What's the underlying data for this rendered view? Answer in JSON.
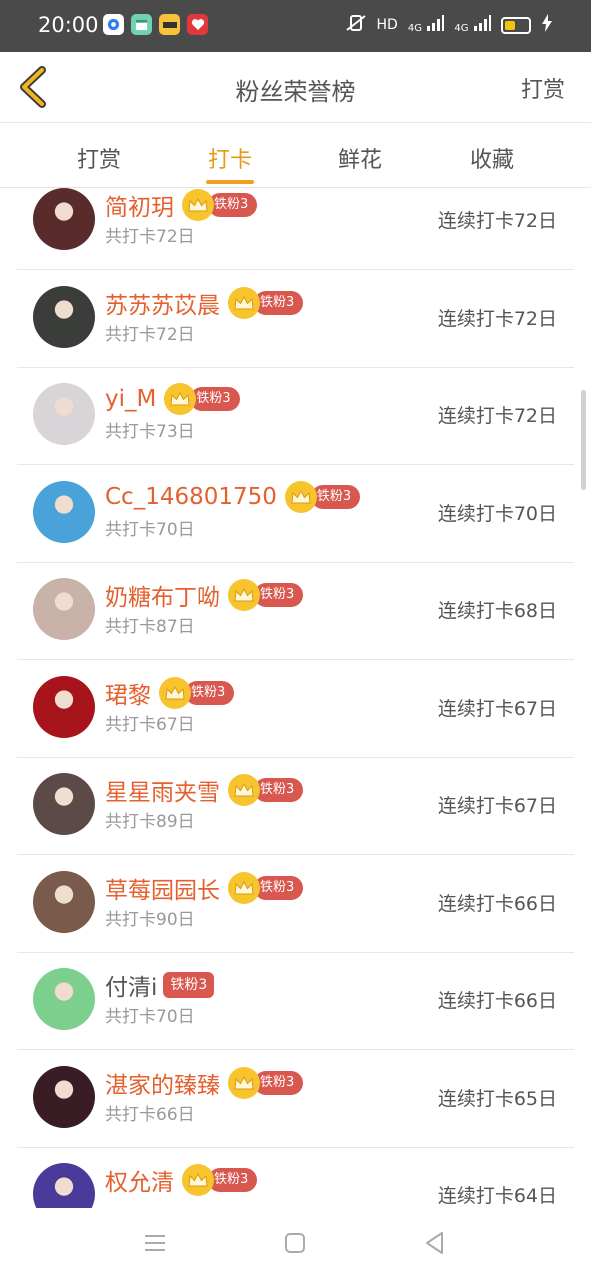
{
  "status_bar": {
    "time": "20:00",
    "right_text": "HD",
    "network": "4G",
    "network2": "4G"
  },
  "header": {
    "title": "粉丝荣誉榜",
    "right_action": "打赏",
    "back_icon": "chevron-left-icon"
  },
  "tabs": [
    {
      "label": "打赏",
      "active": false
    },
    {
      "label": "打卡",
      "active": true
    },
    {
      "label": "鲜花",
      "active": false
    },
    {
      "label": "收藏",
      "active": false
    }
  ],
  "fans": [
    {
      "name": "简初玥",
      "badge": "铁粉3",
      "crown": true,
      "total": "共打卡72日",
      "streak": "连续打卡72日",
      "avatar_color": "#5a2b2b"
    },
    {
      "name": "苏苏苏苡晨",
      "badge": "铁粉3",
      "crown": true,
      "total": "共打卡72日",
      "streak": "连续打卡72日",
      "avatar_color": "#3a3d3a"
    },
    {
      "name": "yi_M",
      "badge": "铁粉3",
      "crown": true,
      "total": "共打卡73日",
      "streak": "连续打卡72日",
      "avatar_color": "#d9d4d8"
    },
    {
      "name": "Cc_146801750",
      "badge": "铁粉3",
      "crown": true,
      "total": "共打卡70日",
      "streak": "连续打卡70日",
      "avatar_color": "#4aa3d8"
    },
    {
      "name": "奶糖布丁呦",
      "badge": "铁粉3",
      "crown": true,
      "total": "共打卡87日",
      "streak": "连续打卡68日",
      "avatar_color": "#c9b2a8"
    },
    {
      "name": "珺黎",
      "badge": "铁粉3",
      "crown": true,
      "total": "共打卡67日",
      "streak": "连续打卡67日",
      "avatar_color": "#a8141c"
    },
    {
      "name": "星星雨夹雪",
      "badge": "铁粉3",
      "crown": true,
      "total": "共打卡89日",
      "streak": "连续打卡67日",
      "avatar_color": "#5b4a48"
    },
    {
      "name": "草莓园园长",
      "badge": "铁粉3",
      "crown": true,
      "total": "共打卡90日",
      "streak": "连续打卡66日",
      "avatar_color": "#7a5a4a"
    },
    {
      "name": "付清i",
      "badge": "铁粉3",
      "crown": false,
      "total": "共打卡70日",
      "streak": "连续打卡66日",
      "avatar_color": "#7dcf8d"
    },
    {
      "name": "湛家的臻臻",
      "badge": "铁粉3",
      "crown": true,
      "total": "共打卡66日",
      "streak": "连续打卡65日",
      "avatar_color": "#3a1c24"
    },
    {
      "name": "权允清",
      "badge": "铁粉3",
      "crown": true,
      "total": "",
      "streak": "连续打卡64日",
      "avatar_color": "#4b3a9a"
    }
  ],
  "colors": {
    "accent": "#f0a020",
    "name_color": "#e4612f",
    "badge_color": "#d8574f",
    "crown_color": "#f7c42e"
  }
}
